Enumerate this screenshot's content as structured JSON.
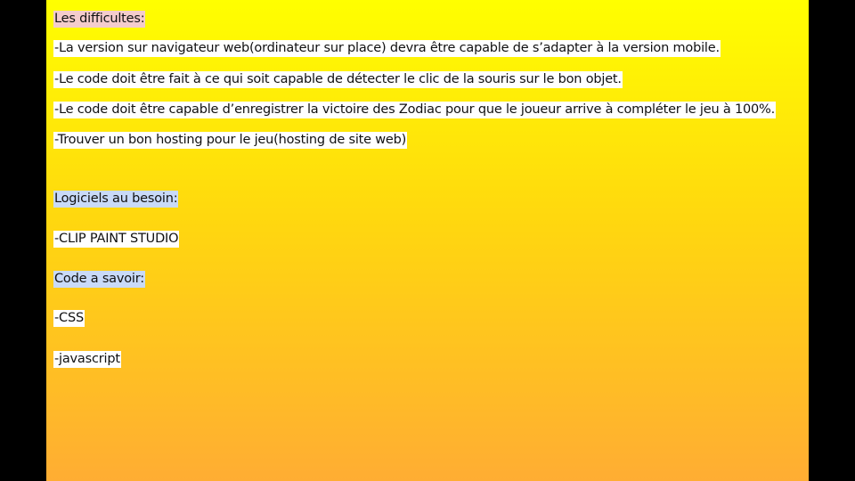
{
  "slide": {
    "background_colors": [
      "#ffff00",
      "#ffad33"
    ],
    "lines": [
      {
        "text": "Les difficultes:",
        "highlight": "#f4cccc"
      },
      {
        "text": "-La version sur navigateur web(ordinateur sur place) devra être capable de s’adapter à la version mobile.",
        "highlight": "#ffffff"
      },
      {
        "text": "-Le code doit être fait à ce qui soit capable de détecter  le clic de la souris sur le bon objet.",
        "highlight": "#ffffff"
      },
      {
        "text": "-Le code doit être capable d’enregistrer la victoire des Zodiac pour que le joueur arrive à compléter le jeu à 100%.",
        "highlight": "#ffffff"
      },
      {
        "text": "-Trouver un bon hosting pour le jeu(hosting de site web)",
        "highlight": "#ffffff"
      },
      {
        "text": "Logiciels au besoin:",
        "highlight": "#c9daf8"
      },
      {
        "text": "-CLIP PAINT STUDIO",
        "highlight": "#ffffff"
      },
      {
        "text": "Code a savoir:",
        "highlight": "#c9daf8"
      },
      {
        "text": "-CSS",
        "highlight": "#ffffff"
      },
      {
        "text": "-javascript",
        "highlight": "#ffffff"
      }
    ]
  }
}
